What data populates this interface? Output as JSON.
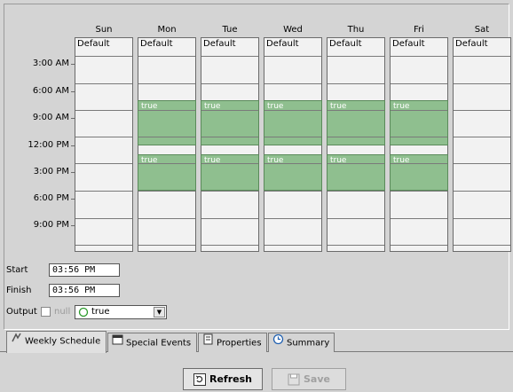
{
  "days": [
    "Sun",
    "Mon",
    "Tue",
    "Wed",
    "Thu",
    "Fri",
    "Sat"
  ],
  "default_label": "Default",
  "times": [
    "3:00 AM",
    "6:00 AM",
    "9:00 AM",
    "12:00 PM",
    "3:00 PM",
    "6:00 PM",
    "9:00 PM"
  ],
  "block_label": "true",
  "block_color": "#8fbf8f",
  "form": {
    "start_label": "Start",
    "start_value": "03:56 PM",
    "finish_label": "Finish",
    "finish_value": "03:56 PM",
    "output_label": "Output",
    "null_label": "null",
    "output_value": "true"
  },
  "tabs": [
    "Weekly Schedule",
    "Special Events",
    "Properties",
    "Summary"
  ],
  "buttons": {
    "refresh": "Refresh",
    "save": "Save"
  }
}
